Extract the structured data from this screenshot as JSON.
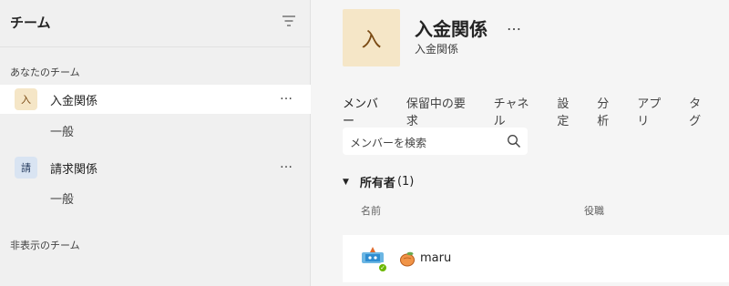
{
  "sidebar": {
    "title": "チーム",
    "your_teams_label": "あなたのチーム",
    "hidden_teams_label": "非表示のチーム",
    "more_label": "…",
    "teams": [
      {
        "avatar_text": "入",
        "avatar_bg": "#f5e6c7",
        "avatar_color": "#7a4a14",
        "name": "入金関係",
        "channel": "一般"
      },
      {
        "avatar_text": "請",
        "avatar_bg": "#d9e4f2",
        "avatar_color": "#243a5e",
        "name": "請求関係",
        "channel": "一般"
      }
    ]
  },
  "main": {
    "avatar_text": "入",
    "title": "入金関係",
    "title_more": "…",
    "subtitle": "入金関係",
    "tabs": [
      "メンバー",
      "保留中の要求",
      "チャネル",
      "設定",
      "分析",
      "アプリ",
      "タグ"
    ],
    "search_placeholder": "メンバーを検索",
    "owners_label": "所有者",
    "owners_count": "(1)",
    "columns": {
      "name": "名前",
      "role": "役職"
    },
    "members": [
      {
        "name": "maru"
      }
    ],
    "accent": "#5b5fc7"
  }
}
